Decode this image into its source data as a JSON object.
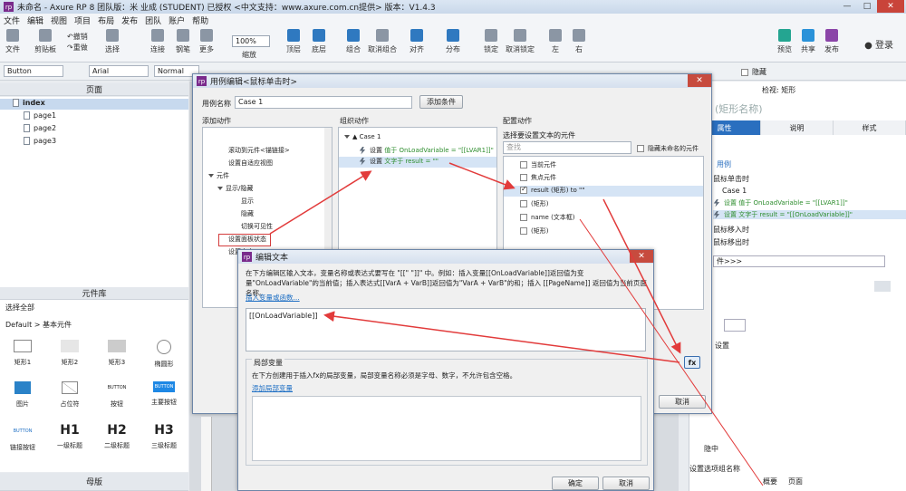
{
  "window": {
    "title": "未命名 - Axure RP 8 团队版：米 业成 (STUDENT) 已授权    <中文支持：www.axure.com.cn提供> 版本：V1.4.3"
  },
  "menu": [
    "文件",
    "编辑",
    "视图",
    "项目",
    "布局",
    "发布",
    "团队",
    "账户",
    "帮助"
  ],
  "toolbar": {
    "file": "文件",
    "clipboard": "剪贴板",
    "undo": "撤销",
    "redo": "重做",
    "select": "选择",
    "connect": "连接",
    "pen": "钢笔",
    "more": "更多",
    "zoom_value": "100%",
    "zoom_label": "缩放",
    "top": "顶层",
    "bottom": "底层",
    "group": "组合",
    "ungroup": "取消组合",
    "align": "对齐",
    "distribute": "分布",
    "lock": "锁定",
    "unlock": "取消锁定",
    "left": "左",
    "right": "右",
    "preview": "预览",
    "share": "共享",
    "publish": "发布",
    "login": "登录"
  },
  "formatbar": {
    "widget": "Button",
    "font": "Arial",
    "style": "Normal",
    "hide": "隐藏"
  },
  "pages_panel": {
    "title": "页面",
    "items": [
      "index",
      "page1",
      "page2",
      "page3"
    ]
  },
  "library_panel": {
    "title": "元件库",
    "select_all": "选择全部",
    "default": "Default > 基本元件",
    "items": [
      "矩形1",
      "矩形2",
      "矩形3",
      "椭圆形",
      "图片",
      "占位符",
      "按钮",
      "主要按钮",
      "链接按钮",
      "一级标题",
      "二级标题",
      "三级标题"
    ],
    "button_text": "BUTTON",
    "h1": "H1",
    "h2": "H2",
    "h3": "H3"
  },
  "masters_panel": {
    "title": "母版"
  },
  "right_panel": {
    "header": "检视: 矩形",
    "shape_name": "(矩形名称)",
    "tabs": [
      "属性",
      "说明",
      "样式"
    ],
    "events": [
      "用例",
      "鼠标单击时",
      "Case 1",
      "设置 值于 OnLoadVariable = \"[[LVAR1]]\"",
      "设置 文字于 result = \"[[OnLoadVariable]]\"",
      "鼠标移入时",
      "鼠标移出时"
    ],
    "more_events": "件>>>",
    "bottom_tabs": [
      "概要",
      "页面"
    ],
    "other": [
      "设置",
      "隐中",
      "设置选项组名称"
    ]
  },
  "case_editor": {
    "title": "用例编辑<鼠标单击时>",
    "case_name_label": "用例名称",
    "case_name_value": "Case 1",
    "add_condition": "添加条件",
    "add_action": "添加动作",
    "organize_action": "组织动作",
    "configure_action": "配置动作",
    "actions_list": [
      "滚动到元件<锚链接>",
      "设置自适应视图",
      "元件",
      "显示/隐藏",
      "显示",
      "隐藏",
      "切换可见性",
      "设置面板状态",
      "设置文本"
    ],
    "org_case": "Case 1",
    "org_actions": [
      {
        "verb": "设置",
        "text": "值于 OnLoadVariable = \"[[LVAR1]]\""
      },
      {
        "verb": "设置",
        "text": "文字于 result = \"\""
      }
    ],
    "config_title": "选择要设置文本的元件",
    "search_placeholder": "查找",
    "hide_unnamed": "隐藏未命名的元件",
    "targets": [
      {
        "label": "当前元件",
        "checked": false
      },
      {
        "label": "焦点元件",
        "checked": false
      },
      {
        "label": "result (矩形) to \"\"",
        "checked": true
      },
      {
        "label": "(矩形)",
        "checked": false
      },
      {
        "label": "name (文本框)",
        "checked": false
      },
      {
        "label": "(矩形)",
        "checked": false
      }
    ],
    "fx": "fx",
    "cancel": "取消"
  },
  "edit_text": {
    "title": "编辑文本",
    "instructions": "在下方编辑区输入文本，变量名称或表达式要写在 \"[[\" \"]]\" 中。例如：插入变量[[OnLoadVariable]]返回值为变量\"OnLoadVariable\"的当前值；插入表达式[[VarA + VarB]]返回值为\"VarA + VarB\"的和；插入 [[PageName]] 返回值为当前页面名称。",
    "insert_link": "插入变量或函数...",
    "content": "[[OnLoadVariable]]",
    "local_vars_title": "局部变量",
    "local_vars_desc": "在下方创建用于插入fx的局部变量，局部变量名称必须是字母、数字，不允许包含空格。",
    "add_local": "添加局部变量",
    "ok": "确定",
    "cancel": "取消"
  }
}
